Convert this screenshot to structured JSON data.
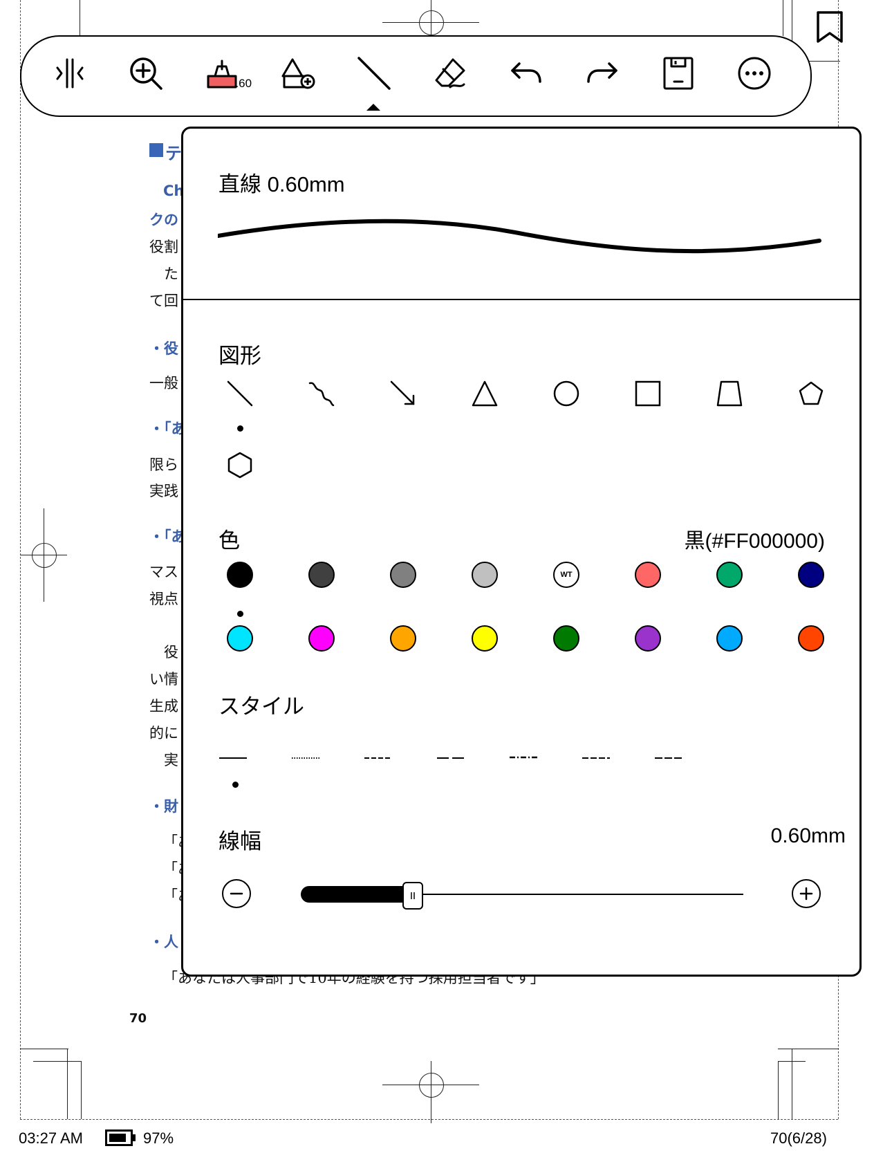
{
  "toolbar": {
    "pen_size": "0.60",
    "buttons": [
      "split-view",
      "zoom-in",
      "pen-color",
      "shape-add",
      "line-tool",
      "eraser",
      "undo",
      "redo",
      "save",
      "more"
    ]
  },
  "panel": {
    "stroke_preview_title": "直線 0.60mm",
    "shape_section": {
      "title": "図形",
      "items": [
        "line",
        "wavy-line",
        "arrow",
        "triangle",
        "circle",
        "square",
        "trapezoid",
        "pentagon",
        "hexagon"
      ],
      "selected": "line"
    },
    "color_section": {
      "title": "色",
      "current": "黒(#FF000000)",
      "swatches": [
        "#000000",
        "#404040",
        "#808080",
        "#c0c0c0",
        "WT",
        "#ff6666",
        "#00a86b",
        "#000080",
        "#00e5ff",
        "#ff00ff",
        "#ffa500",
        "#ffff00",
        "#007a00",
        "#9933cc",
        "#00aaff",
        "#ff4500"
      ],
      "wt_label": "WT",
      "selected_index": 0
    },
    "style_section": {
      "title": "スタイル",
      "styles": [
        "solid",
        "dotted",
        "dashed",
        "long-dash",
        "dash-dot",
        "dash-short",
        "dash-long-short"
      ],
      "selected": "solid"
    },
    "width_section": {
      "title": "線幅",
      "value": "0.60mm",
      "slider_fraction": 0.25
    }
  },
  "document": {
    "lines": [
      "テ",
      "Ch",
      "クの",
      "役割",
      "た",
      "て回",
      "・役",
      "一般",
      "・「あ",
      "限ら",
      "実践",
      "・「あ",
      "マス",
      "視点",
      "役",
      "い情",
      "生成",
      "的に",
      "実",
      "・財",
      "「あ",
      "「あ",
      "「あ",
      "・人"
    ],
    "full_line": "「あなたは人事部門で10年の経験を持つ採用担当者です」",
    "page_number": "70"
  },
  "status": {
    "time": "03:27 AM",
    "battery": "97%",
    "page": "70(6/28)"
  }
}
